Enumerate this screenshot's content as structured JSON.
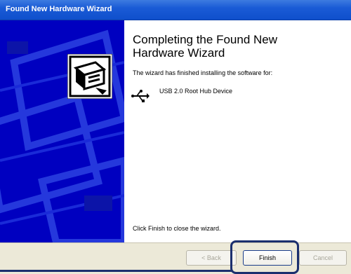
{
  "window": {
    "title": "Found New Hardware Wizard"
  },
  "content": {
    "heading_line1": "Completing the Found New",
    "heading_line2": "Hardware Wizard",
    "subtext": "The wizard has finished installing the software for:",
    "device_name": "USB 2.0 Root Hub Device",
    "device_icon": "usb-icon",
    "close_text": "Click Finish to close the wizard."
  },
  "buttons": {
    "back": "< Back",
    "finish": "Finish",
    "cancel": "Cancel"
  },
  "colors": {
    "title_bar": "#0f4fcc",
    "side_panel": "#0000c0",
    "highlight": "#1b2f6e"
  }
}
